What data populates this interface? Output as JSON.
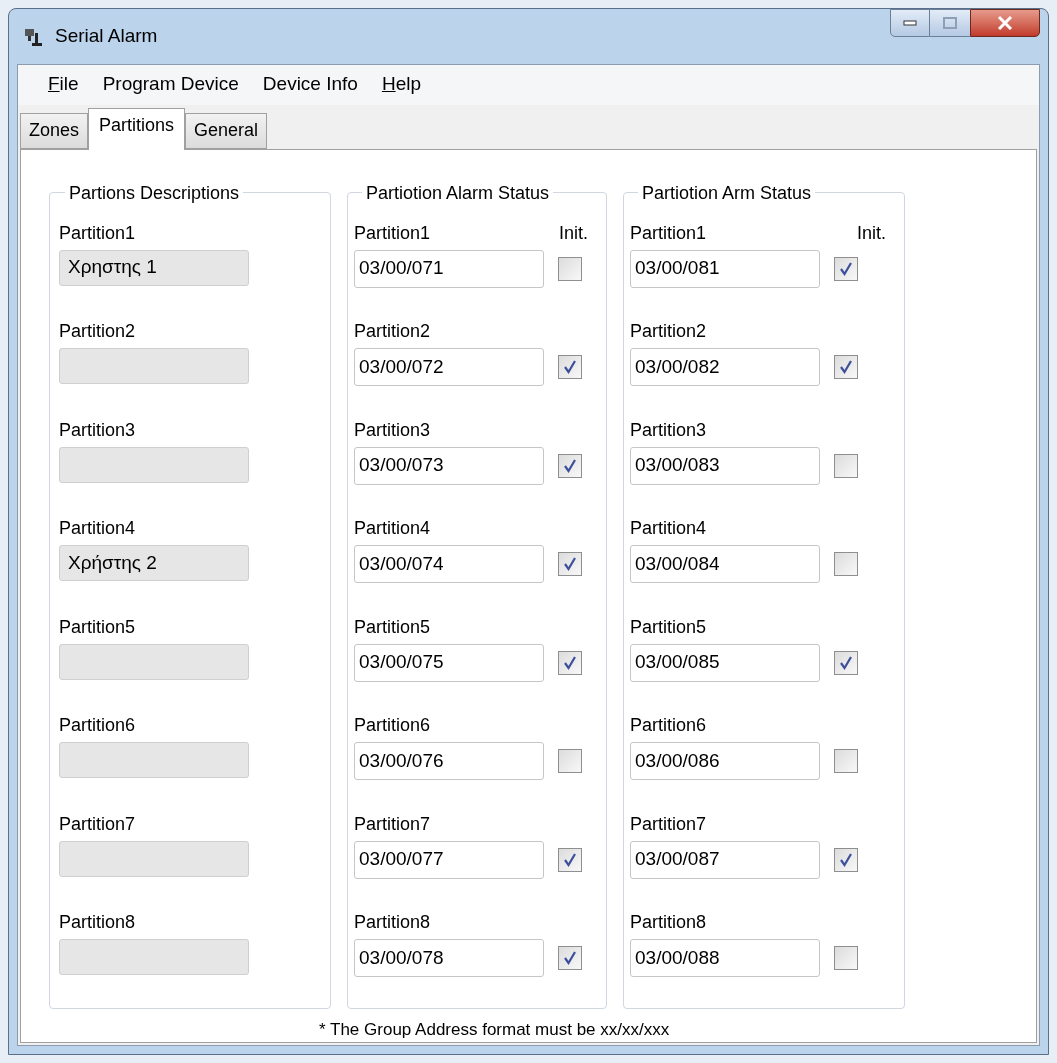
{
  "window": {
    "title": "Serial Alarm"
  },
  "menu": [
    {
      "label": "File",
      "mnemonic": true
    },
    {
      "label": "Program Device",
      "mnemonic": false
    },
    {
      "label": "Device Info",
      "mnemonic": false
    },
    {
      "label": "Help",
      "mnemonic": true
    }
  ],
  "tabs": [
    {
      "label": "Zones",
      "selected": false
    },
    {
      "label": "Partitions",
      "selected": true
    },
    {
      "label": "General",
      "selected": false
    }
  ],
  "descriptions": {
    "title": "Partions Descriptions",
    "rows": [
      {
        "label": "Partition1",
        "value": "Χρηστης 1"
      },
      {
        "label": "Partition2"
      },
      {
        "label": "Partition3"
      },
      {
        "label": "Partition4",
        "value": "Χρήστης 2"
      },
      {
        "label": "Partition5"
      },
      {
        "label": "Partition6"
      },
      {
        "label": "Partition7"
      },
      {
        "label": "Partition8"
      }
    ]
  },
  "alarm_status": {
    "title": "Partiotion Alarm Status",
    "init_label": "Init.",
    "rows": [
      {
        "label": "Partition1",
        "value": "03/00/071",
        "checked": false
      },
      {
        "label": "Partition2",
        "value": "03/00/072",
        "checked": true
      },
      {
        "label": "Partition3",
        "value": "03/00/073",
        "checked": true
      },
      {
        "label": "Partition4",
        "value": "03/00/074",
        "checked": true
      },
      {
        "label": "Partition5",
        "value": "03/00/075",
        "checked": true
      },
      {
        "label": "Partition6",
        "value": "03/00/076",
        "checked": false
      },
      {
        "label": "Partition7",
        "value": "03/00/077",
        "checked": true
      },
      {
        "label": "Partition8",
        "value": "03/00/078",
        "checked": true
      }
    ]
  },
  "arm_status": {
    "title": "Partiotion Arm Status",
    "init_label": "Init.",
    "rows": [
      {
        "label": "Partition1",
        "value": "03/00/081",
        "checked": true
      },
      {
        "label": "Partition2",
        "value": "03/00/082",
        "checked": true
      },
      {
        "label": "Partition3",
        "value": "03/00/083",
        "checked": false
      },
      {
        "label": "Partition4",
        "value": "03/00/084",
        "checked": false
      },
      {
        "label": "Partition5",
        "value": "03/00/085",
        "checked": true
      },
      {
        "label": "Partition6",
        "value": "03/00/086",
        "checked": false
      },
      {
        "label": "Partition7",
        "value": "03/00/087",
        "checked": true
      },
      {
        "label": "Partition8",
        "value": "03/00/088",
        "checked": false
      }
    ]
  },
  "footnote": "* The Group Address format must be xx/xx/xxx"
}
